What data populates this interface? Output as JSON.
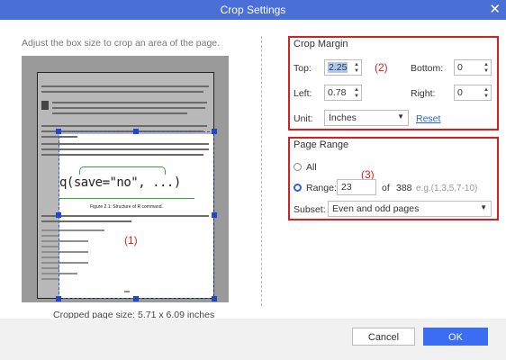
{
  "window": {
    "title": "Crop Settings",
    "close_glyph": "✕"
  },
  "preview": {
    "instruction": "Adjust the box size to crop an area of the page.",
    "code_sample": "q(save=\"no\", ...)",
    "figure_caption": "Figure 2.1: Structure of R command.",
    "annotation_1": "(1)",
    "cropped_size": "Cropped page size: 5.71 x 6.09 inches"
  },
  "crop_margin": {
    "title": "Crop Margin",
    "annotation": "(2)",
    "top_label": "Top:",
    "top_value": "2.25",
    "bottom_label": "Bottom:",
    "bottom_value": "0",
    "left_label": "Left:",
    "left_value": "0.78",
    "right_label": "Right:",
    "right_value": "0",
    "unit_label": "Unit:",
    "unit_value": "Inches",
    "reset_label": "Reset"
  },
  "page_range": {
    "title": "Page Range",
    "annotation": "(3)",
    "all_label": "All",
    "range_label": "Range:",
    "range_value": "23",
    "of_label": "of",
    "total_pages": "388",
    "range_placeholder": "e.g.(1,3,5,7-10)",
    "subset_label": "Subset:",
    "subset_value": "Even and odd pages",
    "selected_option": "Range"
  },
  "buttons": {
    "cancel": "Cancel",
    "ok": "OK"
  },
  "colors": {
    "accent": "#3b6df2",
    "titlebar": "#4a6fd6",
    "annotation_red": "#d81e1e"
  }
}
